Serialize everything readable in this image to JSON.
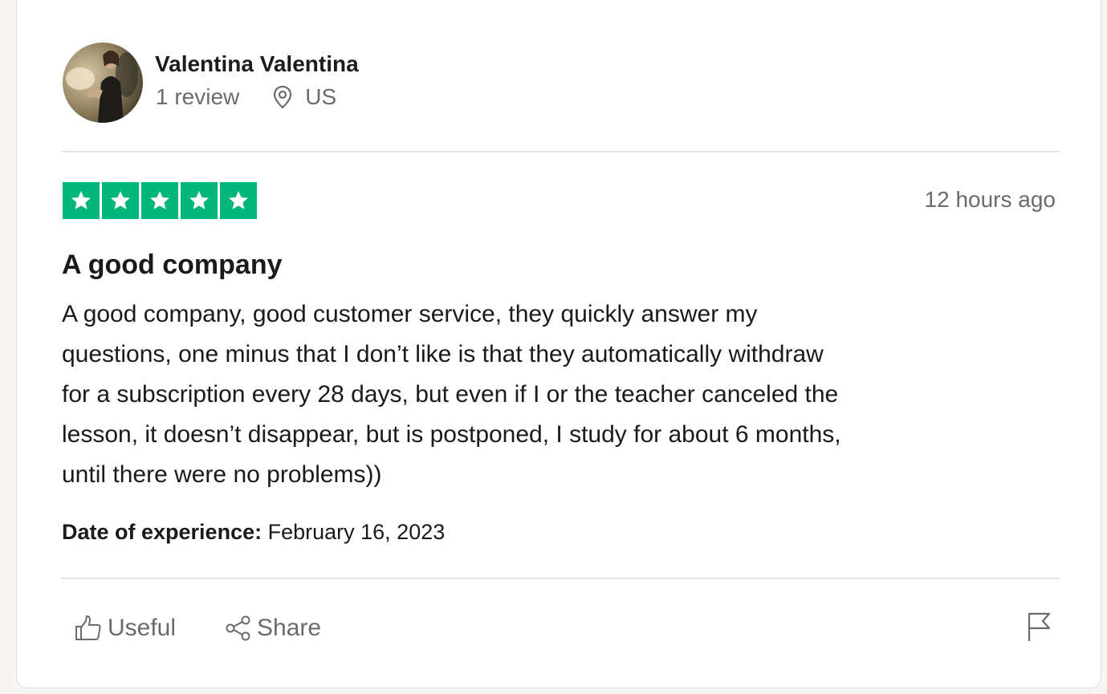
{
  "reviewer": {
    "name": "Valentina Valentina",
    "review_count": "1 review",
    "country": "US"
  },
  "review": {
    "rating": 5,
    "rating_max": 5,
    "posted": "12 hours ago",
    "title": "A good company",
    "body_lines": [
      "A good company, good customer service, they quickly answer my",
      "questions, one minus that I don’t like is that they automatically withdraw",
      "for a subscription every 28 days, but even if I or the teacher canceled the",
      "lesson, it doesn’t disappear, but is postponed, I study for about 6 months,",
      "until there were no problems))"
    ],
    "experience_label": "Date of experience:",
    "experience_date": "February 16, 2023"
  },
  "actions": {
    "useful_label": "Useful",
    "share_label": "Share"
  },
  "icons": {
    "location": "location-pin-icon",
    "useful": "thumbs-up-icon",
    "share": "share-icon",
    "report": "flag-icon",
    "star": "star-icon"
  },
  "colors": {
    "star_green": "#00b67a",
    "muted_text": "#6b6b6b"
  }
}
